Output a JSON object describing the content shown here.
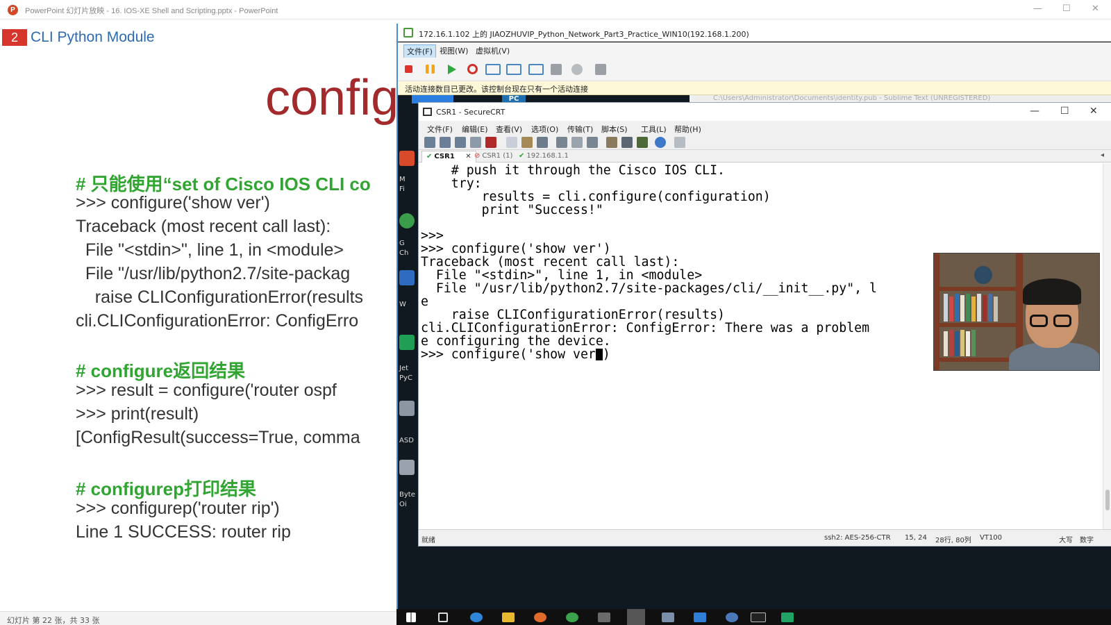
{
  "powerpoint": {
    "window_title": "PowerPoint 幻灯片放映 - 16. IOS-XE Shell and Scripting.pptx - PowerPoint",
    "slide_number": "2",
    "slide_title": "CLI Python Module",
    "big_heading": "config",
    "lines": [
      "# 只能使用“set of Cisco IOS CLI co",
      ">>> configure('show ver')",
      "Traceback (most recent call last):",
      "  File \"<stdin>\", line 1, in <module>",
      "  File \"/usr/lib/python2.7/site-packag",
      "    raise CLIConfigurationError(results",
      "cli.CLIConfigurationError: ConfigErro",
      "# configure返回结果",
      ">>> result = configure('router ospf",
      ">>> print(result)",
      "[ConfigResult(success=True, comma",
      "# configurep打印结果",
      ">>> configurep('router rip')",
      "Line 1 SUCCESS: router rip"
    ],
    "status_text": "幻灯片 第 22 张，共 33 张",
    "accent_green": "#31a531",
    "accent_red": "#a32a2c",
    "title_blue": "#2e6ab0"
  },
  "vmware": {
    "window_title": "172.16.1.102 上的 JIAOZHUVIP_Python_Network_Part3_Practice_WIN10(192.168.1.200)",
    "menu": [
      "文件(F)",
      "视图(W)",
      "虚拟机(V)"
    ],
    "info_bar": "活动连接数目已更改。该控制台现在只有一个活动连接",
    "sublime_title": "C:\\Users\\Administrator\\Documents\\identity.pub - Sublime Text (UNREGISTERED)",
    "desktop_labels": [
      "M",
      "Fi",
      "G",
      "Ch",
      "W",
      "Jet",
      "PyC",
      "ASD",
      "Byte",
      "Oi"
    ]
  },
  "securecrt": {
    "window_title": "CSR1 - SecureCRT",
    "menu": [
      "文件(F)",
      "编辑(E)",
      "查看(V)",
      "选项(O)",
      "传输(T)",
      "脚本(S)",
      "工具(L)",
      "帮助(H)"
    ],
    "tabs": [
      {
        "label": "CSR1",
        "state": "active"
      },
      {
        "label": "CSR1 (1)",
        "state": "disconnected"
      },
      {
        "label": "192.168.1.1",
        "state": "connected"
      }
    ],
    "terminal_lines": [
      "    # push it through the Cisco IOS CLI.",
      "    try:",
      "        results = cli.configure(configuration)",
      "        print \"Success!\"",
      "",
      ">>>",
      ">>> configure('show ver')",
      "Traceback (most recent call last):",
      "  File \"<stdin>\", line 1, in <module>",
      "  File \"/usr/lib/python2.7/site-packages/cli/__init__.py\", l",
      "e",
      "    raise CLIConfigurationError(results)",
      "cli.CLIConfigurationError: ConfigError: There was a problem",
      "e configuring the device."
    ],
    "prompt_before_cursor": ">>> configure('show ver",
    "prompt_after_cursor": ")",
    "status": {
      "ready": "就绪",
      "encryption": "ssh2: AES-256-CTR",
      "position": "15, 24",
      "size": "28行, 80列",
      "term_type": "VT100",
      "caps": "大写",
      "num": "数字"
    }
  }
}
